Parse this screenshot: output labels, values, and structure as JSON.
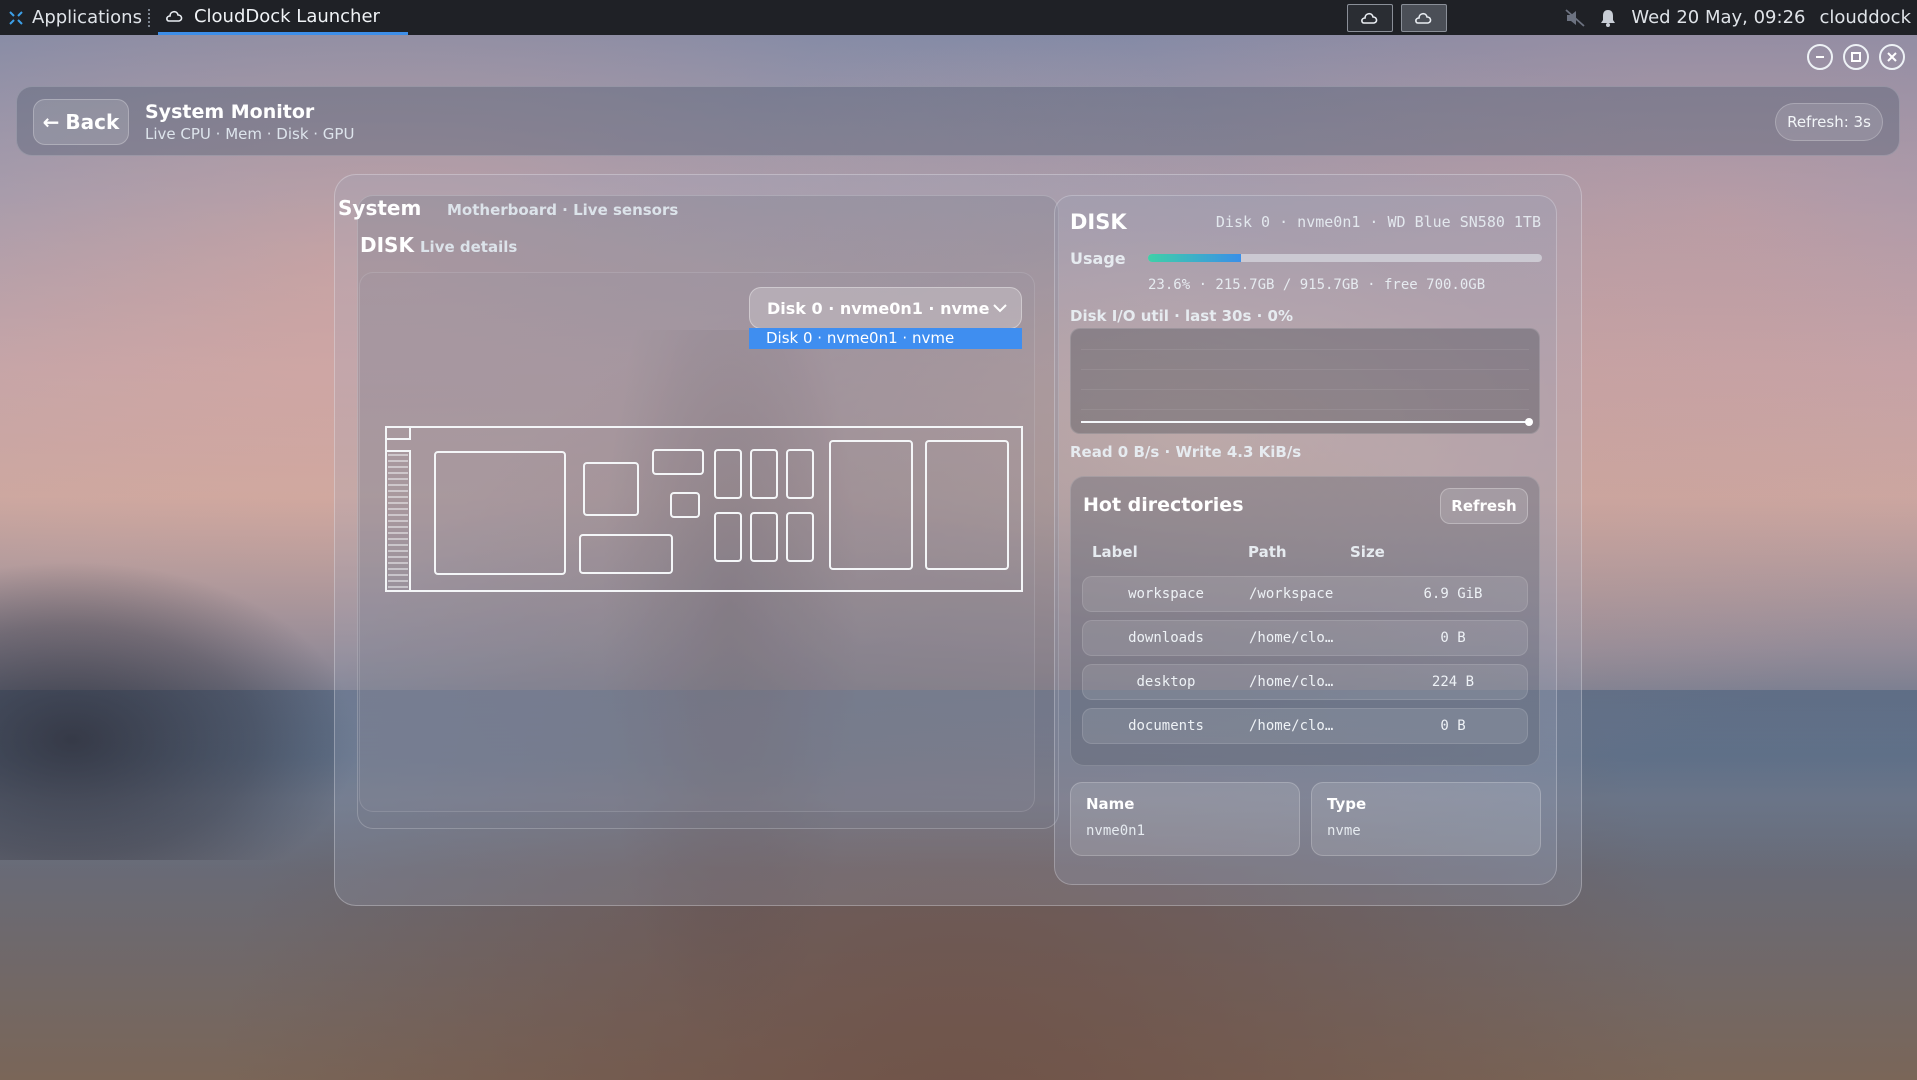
{
  "taskbar": {
    "applications_label": "Applications",
    "active_task_label": "CloudDock Launcher",
    "clock": "Wed 20 May, 09:26",
    "user": "clouddock"
  },
  "header": {
    "back_label": "Back",
    "title": "System Monitor",
    "subtitle": "Live CPU · Mem · Disk · GPU",
    "refresh_label": "Refresh: 3s"
  },
  "left": {
    "system_title": "System",
    "system_subtitle": "Motherboard · Live sensors",
    "disk_title": "DISK",
    "disk_subtitle": "Live details",
    "selected_disk": "Disk 0 · nvme0n1 · nvme",
    "dropdown_options": [
      "Disk 0 · nvme0n1 · nvme"
    ]
  },
  "right": {
    "title": "DISK",
    "model": "Disk 0 · nvme0n1 · WD Blue SN580 1TB",
    "usage_label": "Usage",
    "usage_percent": 23.6,
    "usage_text": "23.6% · 215.7GB / 915.7GB · free 700.0GB",
    "io_label": "Disk I/O util · last 30s · 0%",
    "io_util_percent": 0,
    "rw_text": "Read 0 B/s · Write 4.3 KiB/s",
    "hot": {
      "title": "Hot directories",
      "refresh_label": "Refresh",
      "headers": {
        "label": "Label",
        "path": "Path",
        "size": "Size"
      },
      "rows": [
        {
          "label": "workspace",
          "path": "/workspace",
          "size": "6.9 GiB"
        },
        {
          "label": "downloads",
          "path": "/home/clo…",
          "size": "0 B"
        },
        {
          "label": "desktop",
          "path": "/home/clo…",
          "size": "224 B"
        },
        {
          "label": "documents",
          "path": "/home/clo…",
          "size": "0 B"
        }
      ]
    },
    "info": {
      "name_label": "Name",
      "name_value": "nvme0n1",
      "type_label": "Type",
      "type_value": "nvme"
    }
  },
  "colors": {
    "accent": "#3f8ef0",
    "usage_gradient_start": "#3fd0a8",
    "usage_gradient_end": "#3a8fe8",
    "taskbar_bg": "#1f2126"
  }
}
